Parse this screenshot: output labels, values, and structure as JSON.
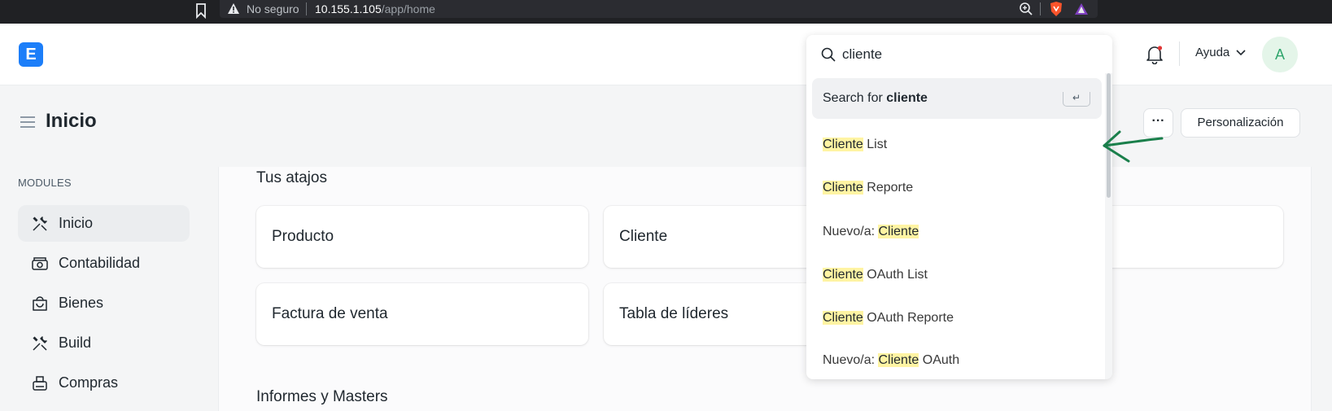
{
  "browser": {
    "insecure_label": "No seguro",
    "url_host": "10.155.1.105",
    "url_path": "/app/home"
  },
  "navbar": {
    "logo_letter": "E",
    "help_label": "Ayuda",
    "avatar_initial": "A"
  },
  "page": {
    "title": "Inicio",
    "more_label": "···",
    "customize_label": "Personalización"
  },
  "sidebar": {
    "heading": "MODULES",
    "items": [
      {
        "label": "Inicio",
        "icon": "tools-icon",
        "active": true
      },
      {
        "label": "Contabilidad",
        "icon": "cash-icon",
        "active": false
      },
      {
        "label": "Bienes",
        "icon": "bag-icon",
        "active": false
      },
      {
        "label": "Build",
        "icon": "tools-icon",
        "active": false
      },
      {
        "label": "Compras",
        "icon": "register-icon",
        "active": false
      }
    ]
  },
  "main": {
    "shortcuts_title": "Tus atajos",
    "shortcuts": [
      "Producto",
      "Cliente",
      "Factura de venta",
      "Tabla de líderes"
    ],
    "reports_title": "Informes y Masters"
  },
  "search": {
    "query": "cliente",
    "first_result_prefix": "Search for ",
    "first_result_term": "cliente",
    "enter_symbol": "↵",
    "results": [
      {
        "pre": "",
        "hl": "Cliente",
        "post": " List"
      },
      {
        "pre": "",
        "hl": "Cliente",
        "post": " Reporte"
      },
      {
        "pre": "Nuevo/a: ",
        "hl": "Cliente",
        "post": ""
      },
      {
        "pre": "",
        "hl": "Cliente",
        "post": " OAuth List"
      },
      {
        "pre": "",
        "hl": "Cliente",
        "post": " OAuth Reporte"
      },
      {
        "pre": "Nuevo/a: ",
        "hl": "Cliente",
        "post": " OAuth"
      }
    ]
  },
  "colors": {
    "accent": "#1c7ef9",
    "highlight": "#fff4a3",
    "annotation": "#1a7f4b"
  }
}
